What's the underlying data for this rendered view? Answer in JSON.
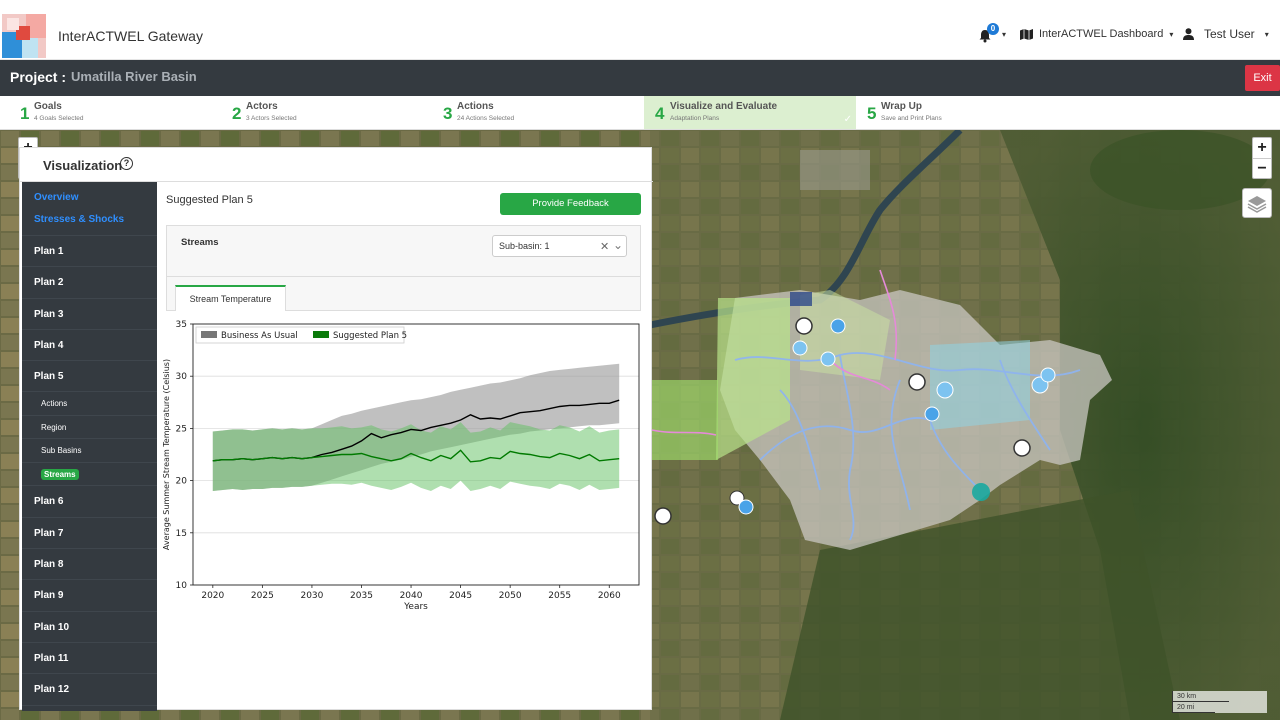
{
  "header": {
    "brand": "InterACTWEL Gateway",
    "notifications_count": "0",
    "dashboard_label": "InterACTWEL Dashboard",
    "user_label": "Test User"
  },
  "project": {
    "label": "Project :",
    "name": "Umatilla River Basin",
    "exit_label": "Exit"
  },
  "steps": [
    {
      "num": "1",
      "title": "Goals",
      "sub": "4 Goals Selected"
    },
    {
      "num": "2",
      "title": "Actors",
      "sub": "3 Actors Selected"
    },
    {
      "num": "3",
      "title": "Actions",
      "sub": "24 Actions Selected"
    },
    {
      "num": "4",
      "title": "Visualize and Evaluate",
      "sub": "Adaptation Plans",
      "check": "✓"
    },
    {
      "num": "5",
      "title": "Wrap Up",
      "sub": "Save and Print Plans"
    }
  ],
  "panel": {
    "title": "Visualization",
    "help": "?"
  },
  "sidebar": {
    "links": [
      "Overview",
      "Stresses & Shocks"
    ],
    "plans_before": [
      "Plan 1",
      "Plan 2",
      "Plan 3",
      "Plan 4",
      "Plan 5"
    ],
    "plan5_sub": [
      "Actions",
      "Region",
      "Sub Basins",
      "Streams"
    ],
    "plans_after": [
      "Plan 6",
      "Plan 7",
      "Plan 8",
      "Plan 9",
      "Plan 10",
      "Plan 11",
      "Plan 12"
    ]
  },
  "content": {
    "plan_title": "Suggested Plan 5",
    "feedback_label": "Provide Feedback",
    "card_title": "Streams",
    "select_value": "Sub-basin: 1",
    "tab_label": "Stream Temperature"
  },
  "map": {
    "zoom_in": "+",
    "zoom_out": "−",
    "scale_km": "30 km",
    "scale_mi": "20 mi"
  },
  "colors": {
    "accent_green": "#28a745",
    "dark_bar": "#343a40",
    "exit_red": "#dc3545",
    "link_blue": "#2f8fff",
    "bau_fill": "#9e9e9e",
    "plan_fill": "#5fbf5f"
  },
  "chart_data": {
    "type": "line",
    "xlabel": "Years",
    "ylabel": "Average Summer Stream Temperature (Celsius)",
    "xlim": [
      2018,
      2063
    ],
    "ylim": [
      10,
      35
    ],
    "xticks": [
      2020,
      2025,
      2030,
      2035,
      2040,
      2045,
      2050,
      2055,
      2060
    ],
    "yticks": [
      10,
      15,
      20,
      25,
      30,
      35
    ],
    "grid": "y",
    "legend_position": "top-left",
    "x": [
      2020,
      2021,
      2022,
      2023,
      2024,
      2025,
      2026,
      2027,
      2028,
      2029,
      2030,
      2031,
      2032,
      2033,
      2034,
      2035,
      2036,
      2037,
      2038,
      2039,
      2040,
      2041,
      2042,
      2043,
      2044,
      2045,
      2046,
      2047,
      2048,
      2049,
      2050,
      2051,
      2052,
      2053,
      2054,
      2055,
      2056,
      2057,
      2058,
      2059,
      2060,
      2061
    ],
    "series": [
      {
        "name": "Business As Usual",
        "color": "#000000",
        "band_color": "#9e9e9e",
        "mean": [
          21.9,
          22.0,
          22.0,
          22.1,
          22.0,
          22.1,
          22.2,
          22.1,
          22.2,
          22.1,
          22.2,
          22.5,
          22.7,
          23.0,
          23.3,
          23.8,
          24.5,
          24.1,
          24.4,
          24.6,
          24.9,
          24.8,
          25.1,
          25.3,
          25.5,
          25.8,
          26.3,
          25.9,
          26.0,
          25.9,
          26.2,
          26.5,
          26.6,
          26.7,
          26.9,
          27.1,
          27.2,
          27.2,
          27.3,
          27.4,
          27.4,
          27.7
        ],
        "upper": [
          24.7,
          24.8,
          24.9,
          24.9,
          24.8,
          24.9,
          25.0,
          24.9,
          25.0,
          24.9,
          25.0,
          25.4,
          25.8,
          26.2,
          26.4,
          26.7,
          26.9,
          27.1,
          27.3,
          27.5,
          27.7,
          27.8,
          28.0,
          28.2,
          28.5,
          28.7,
          28.9,
          29.1,
          29.3,
          29.4,
          29.6,
          29.8,
          30.1,
          30.3,
          30.5,
          30.6,
          30.7,
          30.8,
          30.9,
          31.0,
          31.1,
          31.2
        ],
        "lower": [
          19.0,
          19.1,
          19.2,
          19.1,
          19.2,
          19.2,
          19.3,
          19.3,
          19.4,
          19.4,
          19.5,
          19.8,
          20.1,
          20.4,
          20.7,
          21.0,
          21.3,
          21.6,
          21.8,
          22.0,
          22.3,
          22.5,
          22.8,
          23.0,
          23.2,
          23.4,
          23.6,
          23.8,
          24.0,
          24.2,
          24.4,
          24.5,
          24.7,
          24.8,
          24.9,
          25.0,
          25.1,
          25.2,
          25.3,
          25.3,
          25.4,
          25.5
        ]
      },
      {
        "name": "Suggested Plan 5",
        "color": "#007a00",
        "band_color": "#5fbf5f",
        "mean": [
          21.9,
          22.0,
          22.0,
          22.1,
          22.0,
          22.1,
          22.2,
          22.1,
          22.2,
          22.1,
          22.2,
          22.3,
          22.4,
          22.5,
          22.5,
          22.6,
          22.3,
          22.1,
          21.9,
          22.1,
          22.6,
          22.2,
          21.9,
          22.4,
          22.1,
          22.9,
          21.8,
          21.9,
          22.2,
          22.1,
          22.8,
          22.6,
          22.5,
          22.3,
          22.2,
          22.6,
          22.4,
          22.1,
          22.5,
          21.9,
          22.0,
          22.1
        ],
        "upper": [
          24.7,
          24.8,
          24.9,
          24.9,
          24.8,
          24.9,
          25.0,
          24.9,
          25.0,
          24.9,
          25.0,
          25.0,
          25.1,
          25.2,
          25.0,
          25.1,
          25.3,
          24.9,
          24.7,
          25.0,
          25.4,
          24.8,
          24.6,
          25.2,
          24.9,
          25.6,
          24.6,
          24.7,
          25.1,
          24.8,
          25.6,
          25.4,
          25.2,
          24.9,
          24.8,
          25.3,
          25.1,
          24.7,
          25.2,
          24.6,
          24.8,
          24.9
        ],
        "lower": [
          19.0,
          19.1,
          19.2,
          19.1,
          19.2,
          19.2,
          19.3,
          19.3,
          19.4,
          19.4,
          19.5,
          19.6,
          19.7,
          19.7,
          19.6,
          19.8,
          19.5,
          19.3,
          19.1,
          19.4,
          19.8,
          19.3,
          19.0,
          19.5,
          19.2,
          20.0,
          19.0,
          19.2,
          19.5,
          19.2,
          19.9,
          19.7,
          19.5,
          19.4,
          19.2,
          19.7,
          19.5,
          19.1,
          19.6,
          19.1,
          19.2,
          19.3
        ]
      }
    ]
  }
}
